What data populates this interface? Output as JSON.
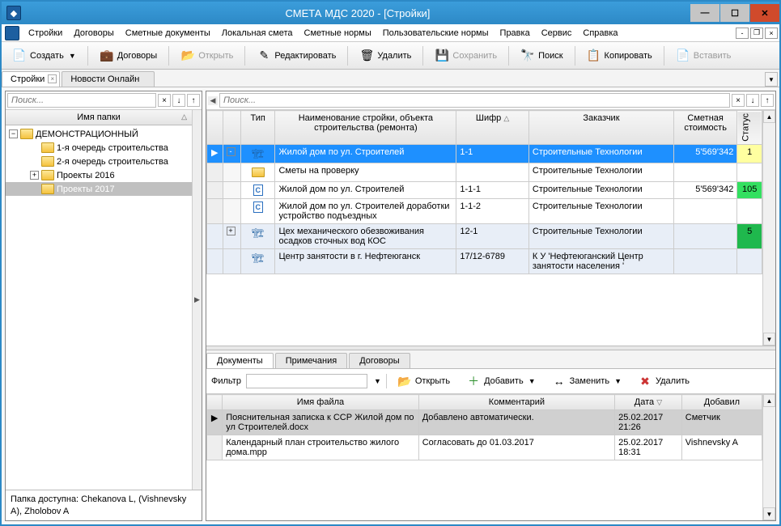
{
  "title": "СМЕТА МДС 2020    -  [Стройки]",
  "menu": [
    "Стройки",
    "Договоры",
    "Сметные документы",
    "Локальная смета",
    "Сметные нормы",
    "Пользовательские нормы",
    "Правка",
    "Сервис",
    "Справка"
  ],
  "toolbar": {
    "create": "Создать",
    "contracts": "Договоры",
    "open": "Открыть",
    "edit": "Редактировать",
    "delete": "Удалить",
    "save": "Сохранить",
    "find": "Поиск",
    "copy": "Копировать",
    "paste": "Вставить"
  },
  "tabs": {
    "t1": "Стройки",
    "t2": "Новости Онлайн"
  },
  "search": {
    "left_ph": "Поиск...",
    "right_ph": "Поиск..."
  },
  "tree": {
    "header": "Имя папки",
    "root": "ДЕМОНСТРАЦИОННЫЙ",
    "items": [
      "1-я очередь строительства",
      "2-я очередь строительства",
      "Проекты 2016",
      "Проекты 2017"
    ]
  },
  "grid": {
    "cols": {
      "type": "Тип",
      "name": "Наименование стройки, объекта строительства (ремонта)",
      "code": "Шифр",
      "customer": "Заказчик",
      "cost": "Сметная стоимость",
      "status": "Статус"
    },
    "rows": [
      {
        "kind": "build",
        "name": "Жилой дом по ул. Строителей",
        "code": "1-1",
        "cust": "Строительные Технологии",
        "cost": "5'569'342",
        "status": "1",
        "sel": true,
        "exp": "-"
      },
      {
        "kind": "fold",
        "name": "Сметы на проверку",
        "code": "",
        "cust": "Строительные Технологии",
        "cost": "",
        "status": ""
      },
      {
        "kind": "doc",
        "name": "Жилой дом по ул. Строителей",
        "code": "1-1-1",
        "cust": "Строительные Технологии",
        "cost": "5'569'342",
        "status": "105"
      },
      {
        "kind": "doc",
        "name": "Жилой дом по ул. Строителей доработки устройство подъездных",
        "code": "1-1-2",
        "cust": "Строительные Технологии",
        "cost": "",
        "status": ""
      },
      {
        "kind": "build",
        "name": "Цех механического обезвоживания осадков сточных вод КОС",
        "code": "12-1",
        "cust": "Строительные Технологии",
        "cost": "",
        "status": "5",
        "alt": true,
        "exp": "+"
      },
      {
        "kind": "build",
        "name": "Центр занятости в г. Нефтеюганск",
        "code": "17/12-6789",
        "cust": "К У 'Нефтеюганский Центр занятости населения '",
        "cost": "",
        "status": "",
        "alt": true
      }
    ]
  },
  "details": {
    "tabs": [
      "Документы",
      "Примечания",
      "Договоры"
    ],
    "filter_label": "Фильтр",
    "btns": {
      "open": "Открыть",
      "add": "Добавить",
      "replace": "Заменить",
      "delete": "Удалить"
    },
    "cols": {
      "file": "Имя файла",
      "comment": "Комментарий",
      "date": "Дата",
      "author": "Добавил"
    },
    "rows": [
      {
        "file": "Пояснительная записка к ССР Жилой дом по ул Строителей.docx",
        "comment": "Добавлено автоматически.",
        "date": "25.02.2017 21:26",
        "author": "Сметчик",
        "sel": true
      },
      {
        "file": "Календарный план строительство жилого дома.mpp",
        "comment": "Согласовать до 01.03.2017",
        "date": "25.02.2017 18:31",
        "author": "Vishnevsky A"
      }
    ]
  },
  "status": "Папка доступна: Chekanova L, (Vishnevsky A), Zholobov A"
}
